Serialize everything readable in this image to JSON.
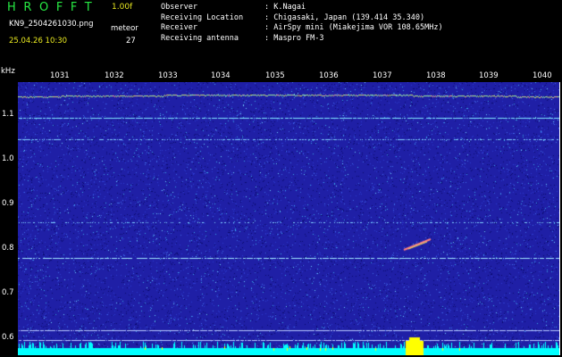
{
  "header": {
    "logo": "HROFFT",
    "version": "1.00f",
    "file_name": "KN9_2504261030.png",
    "meteor_label": "meteor",
    "meteor_count": "27",
    "datetime": "25.04.26 10:30"
  },
  "info": [
    {
      "label": "Observer",
      "value": ": K.Nagai"
    },
    {
      "label": "Receiving Location",
      "value": ": Chigasaki, Japan (139.414 35.340)"
    },
    {
      "label": "Receiver",
      "value": ": AirSpy mini (Miakejima VOR 108.65MHz)"
    },
    {
      "label": "Receiving antenna",
      "value": ": Maspro FM-3"
    }
  ],
  "axis": {
    "unit": "kHz",
    "time_ticks": [
      "1031",
      "1032",
      "1033",
      "1034",
      "1035",
      "1036",
      "1037",
      "1038",
      "1039",
      "1040"
    ],
    "freq_ticks": [
      "1.1",
      "1.0",
      "0.9",
      "0.8",
      "0.7",
      "0.6"
    ]
  },
  "colors": {
    "background": "#000000",
    "logo": "#27e843",
    "accent_yellow": "#e8e820",
    "text": "#ffffff",
    "waterfall_base": "#1f1fa6",
    "noise_floor": "#00ffff"
  }
}
